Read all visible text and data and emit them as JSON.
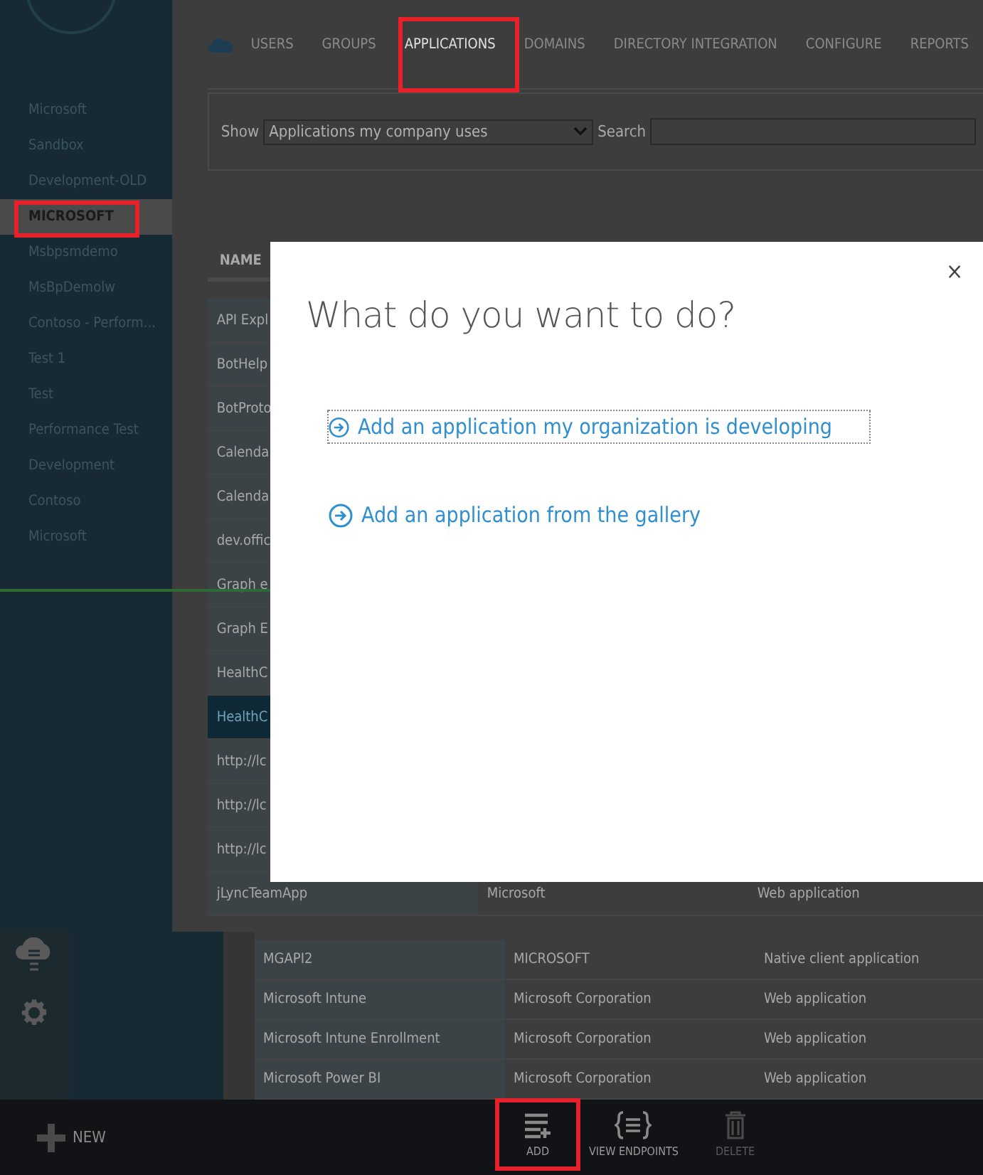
{
  "sidebar": {
    "items": [
      {
        "label": "Microsoft",
        "selected": false
      },
      {
        "label": "Sandbox",
        "selected": false
      },
      {
        "label": "Development-OLD",
        "selected": false
      },
      {
        "label": "MICROSOFT",
        "selected": true
      },
      {
        "label": "Msbpsmdemo",
        "selected": false
      },
      {
        "label": "MsBpDemolw",
        "selected": false
      },
      {
        "label": "Contoso - Perform...",
        "selected": false
      },
      {
        "label": "Test 1",
        "selected": false
      },
      {
        "label": "Test",
        "selected": false
      },
      {
        "label": "Performance Test",
        "selected": false
      },
      {
        "label": "Development",
        "selected": false
      },
      {
        "label": "Contoso",
        "selected": false
      },
      {
        "label": "Microsoft",
        "selected": false
      }
    ]
  },
  "nav": {
    "tabs": [
      {
        "label": "USERS",
        "selected": false
      },
      {
        "label": "GROUPS",
        "selected": false
      },
      {
        "label": "APPLICATIONS",
        "selected": true
      },
      {
        "label": "DOMAINS",
        "selected": false
      },
      {
        "label": "DIRECTORY INTEGRATION",
        "selected": false
      },
      {
        "label": "CONFIGURE",
        "selected": false
      },
      {
        "label": "REPORTS",
        "selected": false
      }
    ]
  },
  "filter": {
    "show_label": "Show",
    "show_value": "Applications my company uses",
    "search_label": "Search"
  },
  "table": {
    "columns": [
      "NAME"
    ],
    "rows": [
      {
        "cells": [
          "API Expl"
        ],
        "selected": false
      },
      {
        "cells": [
          "BotHelp"
        ],
        "selected": false
      },
      {
        "cells": [
          "BotProto"
        ],
        "selected": false
      },
      {
        "cells": [
          "Calenda"
        ],
        "selected": false
      },
      {
        "cells": [
          "Calenda"
        ],
        "selected": false
      },
      {
        "cells": [
          "dev.offic"
        ],
        "selected": false
      },
      {
        "cells": [
          "Graph e"
        ],
        "selected": false
      },
      {
        "cells": [
          "Graph E"
        ],
        "selected": false
      },
      {
        "cells": [
          "HealthC"
        ],
        "selected": false
      },
      {
        "cells": [
          "HealthC"
        ],
        "selected": true
      },
      {
        "cells": [
          "http://lc"
        ],
        "selected": false
      },
      {
        "cells": [
          "http://lc"
        ],
        "selected": false
      },
      {
        "cells": [
          "http://lc"
        ],
        "selected": false
      },
      {
        "cells": [
          "jLyncTeamApp",
          "Microsoft",
          "Web application"
        ],
        "selected": false
      }
    ]
  },
  "table_2": {
    "rows": [
      {
        "cells": [
          "MGAPI2",
          "MICROSOFT",
          "Native client application"
        ]
      },
      {
        "cells": [
          "Microsoft Intune",
          "Microsoft Corporation",
          "Web application"
        ]
      },
      {
        "cells": [
          "Microsoft Intune Enrollment",
          "Microsoft Corporation",
          "Web application"
        ]
      },
      {
        "cells": [
          "Microsoft Power BI",
          "Microsoft Corporation",
          "Web application"
        ]
      }
    ]
  },
  "command_bar": {
    "new_label": "NEW",
    "actions": [
      {
        "kind": "add",
        "label": "ADD",
        "disabled": false
      },
      {
        "kind": "endpoints",
        "label": "VIEW ENDPOINTS",
        "disabled": false
      },
      {
        "kind": "delete",
        "label": "DELETE",
        "disabled": true
      }
    ]
  },
  "dialog": {
    "close": "×",
    "title": "What do you want to do?",
    "options": [
      {
        "label": "Add an application my organization is developing",
        "focused": true
      },
      {
        "label": "Add an application from the gallery",
        "focused": false
      }
    ]
  }
}
